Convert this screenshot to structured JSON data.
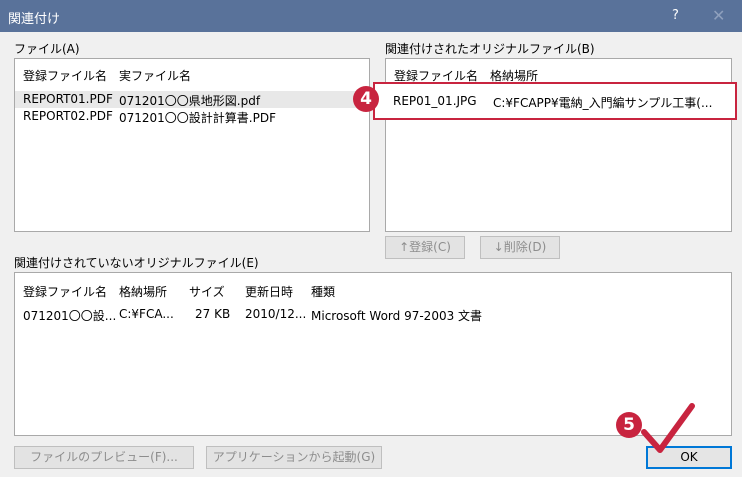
{
  "window": {
    "title": "関連付け",
    "help": "?",
    "close": "✕"
  },
  "files": {
    "label": "ファイル(A)",
    "headers": [
      "登録ファイル名",
      "実ファイル名"
    ],
    "rows": [
      [
        "REPORT01.PDF",
        "071201〇〇県地形図.pdf"
      ],
      [
        "REPORT02.PDF",
        "071201〇〇設計計算書.PDF"
      ]
    ]
  },
  "linked": {
    "label": "関連付けされたオリジナルファイル(B)",
    "headers": [
      "登録ファイル名",
      "格納場所"
    ],
    "rows": [
      [
        "REP01_01.JPG",
        "C:¥FCAPP¥電納_入門編サンプル工事(..."
      ]
    ]
  },
  "buttons": {
    "register": "↑登録(C)",
    "delete": "↓削除(D)",
    "preview": "ファイルのプレビュー(F)...",
    "launch": "アプリケーションから起動(G)",
    "ok": "OK"
  },
  "unlinked": {
    "label": "関連付けされていないオリジナルファイル(E)",
    "headers": [
      "登録ファイル名",
      "格納場所",
      "サイズ",
      "更新日時",
      "種類"
    ],
    "rows": [
      [
        "071201〇〇設...",
        "C:¥FCA...",
        "27 KB",
        "2010/12...",
        "Microsoft Word 97-2003 文書"
      ]
    ]
  },
  "annotations": {
    "step4": "4",
    "step5": "5",
    "check_icon": "check-mark",
    "accent": "#c8243f"
  }
}
